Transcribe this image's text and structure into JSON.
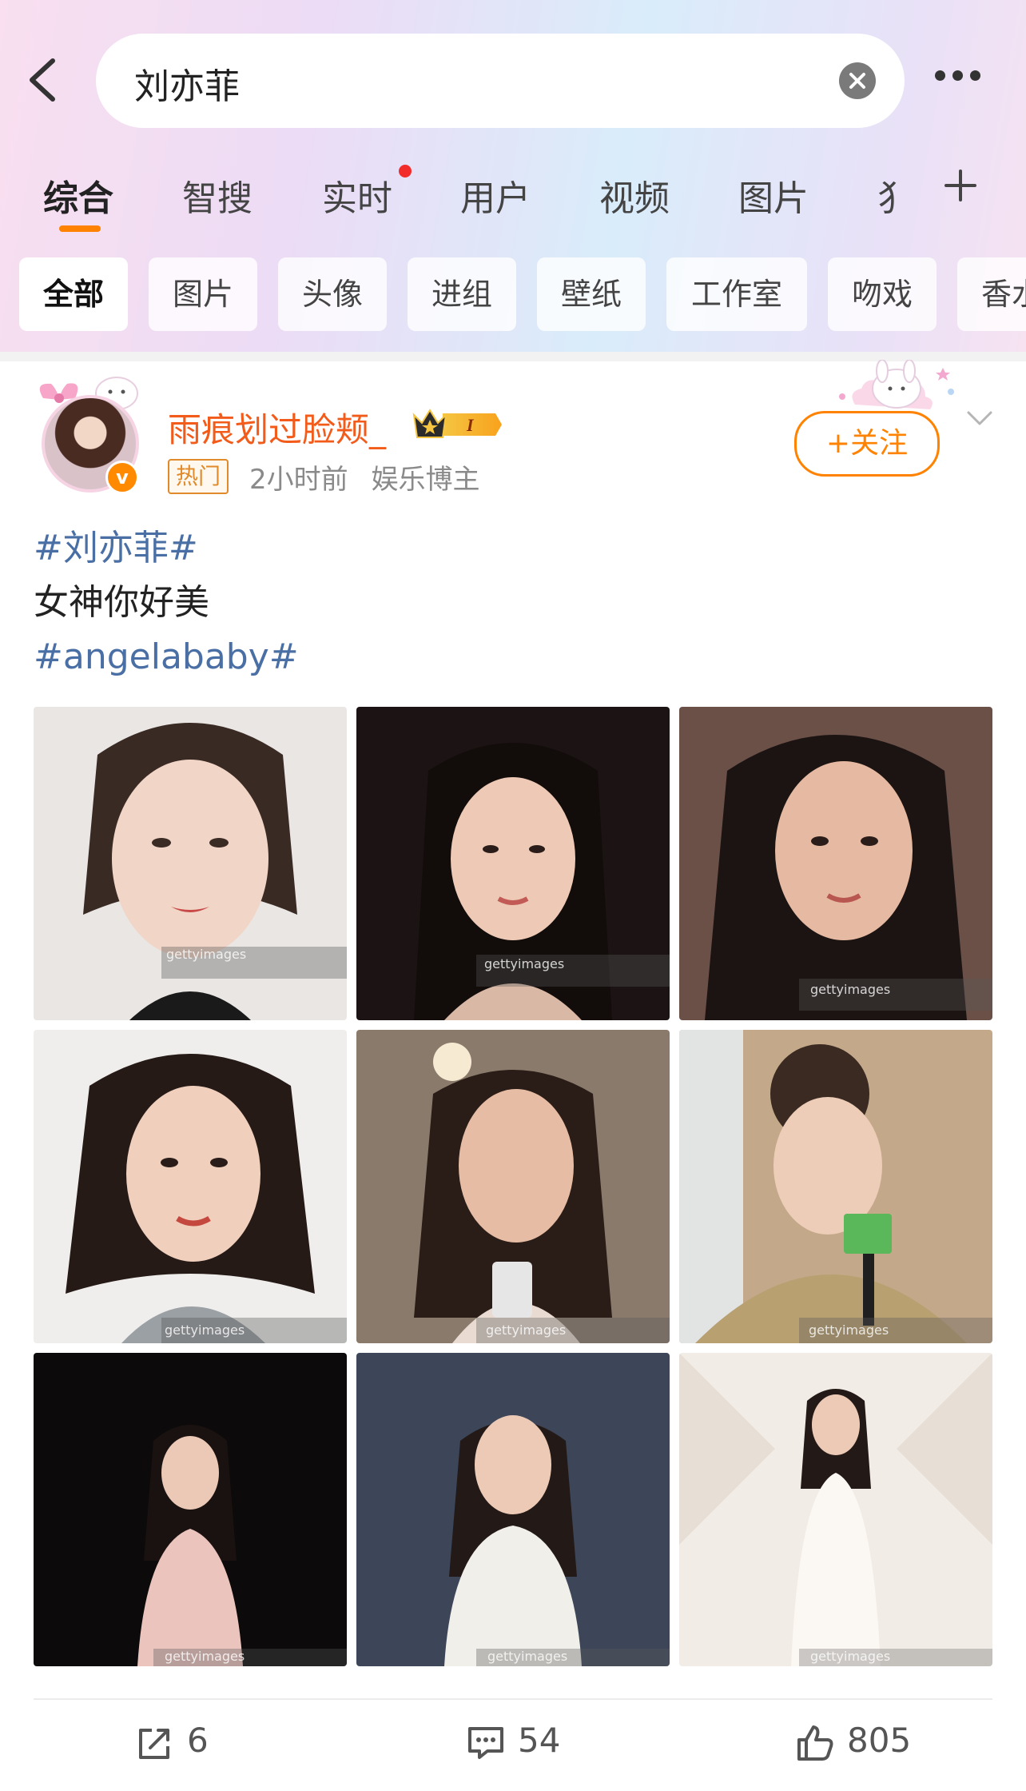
{
  "search": {
    "query": "刘亦菲"
  },
  "tabs": [
    {
      "label": "综合"
    },
    {
      "label": "智搜"
    },
    {
      "label": "实时"
    },
    {
      "label": "用户"
    },
    {
      "label": "视频"
    },
    {
      "label": "图片"
    },
    {
      "label": "犭"
    }
  ],
  "chips": [
    {
      "label": "全部"
    },
    {
      "label": "图片"
    },
    {
      "label": "头像"
    },
    {
      "label": "进组"
    },
    {
      "label": "壁纸"
    },
    {
      "label": "工作室"
    },
    {
      "label": "吻戏"
    },
    {
      "label": "香水"
    }
  ],
  "post": {
    "username": "雨痕划过脸颊_",
    "vip_level": "I",
    "hot_tag": "热门",
    "time": "2小时前",
    "source": "娱乐博主",
    "follow_label": "+关注",
    "verified_mark": "v",
    "lines": [
      "#刘亦菲#",
      "女神你好美",
      "#angelababy#"
    ],
    "photos": [
      {
        "watermark": "gettyimages"
      },
      {
        "watermark": "gettyimages"
      },
      {
        "watermark": "gettyimages"
      },
      {
        "watermark": "gettyimages"
      },
      {
        "watermark": "gettyimages"
      },
      {
        "watermark": "gettyimages"
      },
      {
        "watermark": "gettyimages"
      },
      {
        "watermark": "gettyimages"
      },
      {
        "watermark": "gettyimages"
      }
    ]
  },
  "actions": {
    "repost": "6",
    "comment": "54",
    "like": "805"
  },
  "colors": {
    "accent": "#ff8200",
    "username": "#f25b1a",
    "hashtag": "#4a6fa5"
  }
}
